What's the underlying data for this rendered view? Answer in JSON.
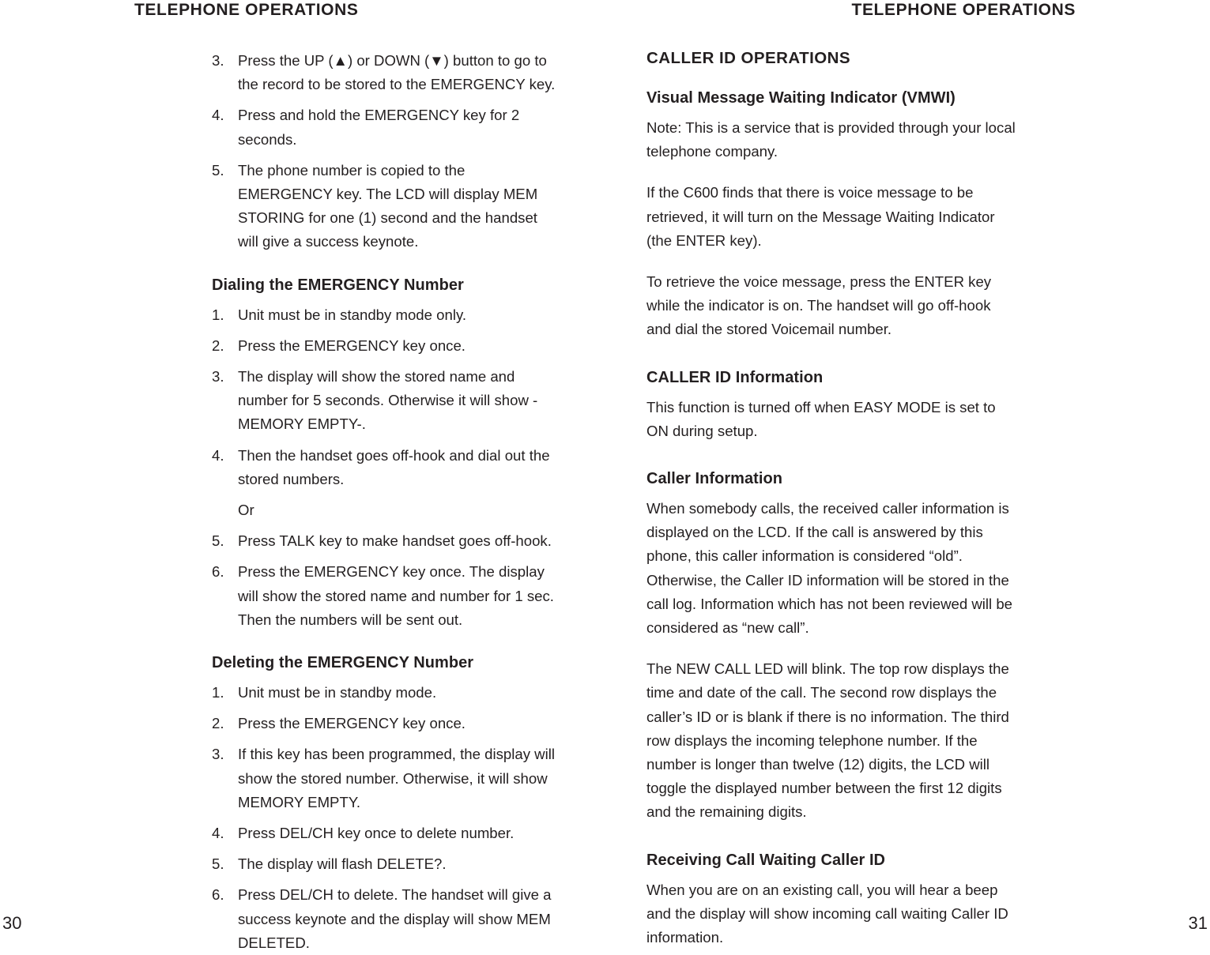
{
  "document": {
    "running_head_left": "TELEPHONE OPERATIONS",
    "running_head_right": "TELEPHONE OPERATIONS",
    "folio_left": "30",
    "folio_right": "31",
    "text_color": "#231f20",
    "background_color": "#ffffff"
  },
  "left_page": {
    "continued_steps": [
      {
        "num": "3.",
        "text": "Press the UP (▲) or DOWN (▼) button to go to the record to be stored to the EMERGENCY key."
      },
      {
        "num": "4.",
        "text": "Press and hold the EMERGENCY key for 2 seconds."
      },
      {
        "num": "5.",
        "text": "The phone number is copied to the EMERGENCY key. The LCD will display MEM STORING for one (1) second and the handset will give a success keynote."
      }
    ],
    "dialing_section": {
      "heading": "Dialing the EMERGENCY Number",
      "steps": [
        {
          "num": "1.",
          "text": "Unit must be in standby mode only."
        },
        {
          "num": "2.",
          "text": "Press the EMERGENCY key once."
        },
        {
          "num": "3.",
          "text": "The display will show the stored name and number for 5 seconds. Otherwise it will show -MEMORY EMPTY-."
        },
        {
          "num": "4.",
          "text": "Then the handset goes off-hook and dial out the stored numbers."
        },
        {
          "num": "",
          "text": "Or"
        },
        {
          "num": "5.",
          "text": "Press TALK key to make handset goes off-hook."
        },
        {
          "num": "6.",
          "text": "Press the EMERGENCY key once. The display will show the stored name and number for 1 sec. Then the numbers will be sent out."
        }
      ]
    },
    "deleting_section": {
      "heading": "Deleting the EMERGENCY Number",
      "steps": [
        {
          "num": "1.",
          "text": "Unit must be in standby mode."
        },
        {
          "num": "2.",
          "text": "Press the EMERGENCY key once."
        },
        {
          "num": "3.",
          "text": "If this key has been programmed, the display will show the stored number. Otherwise, it will show MEMORY EMPTY."
        },
        {
          "num": "4.",
          "text": "Press DEL/CH key once to delete number."
        },
        {
          "num": "5.",
          "text": "The display will flash DELETE?."
        },
        {
          "num": "6.",
          "text": "Press DEL/CH to delete. The handset will give a success keynote and the display will show MEM DELETED."
        }
      ]
    }
  },
  "right_page": {
    "section_heading": "CALLER ID OPERATIONS",
    "vmwi": {
      "heading": "Visual Message Waiting Indicator (VMWI)",
      "paragraphs": [
        "Note: This is a service that is provided through your local telephone company.",
        "If the C600 finds that there is voice message to be retrieved, it will turn on the Message Waiting Indicator (the ENTER key).",
        "To retrieve the voice message, press the ENTER key while the indicator is on. The handset will go off-hook and dial the stored Voicemail number."
      ]
    },
    "caller_id_information": {
      "heading": "CALLER ID Information",
      "paragraphs": [
        "This function is turned off when EASY MODE is set to ON during setup."
      ]
    },
    "caller_information": {
      "heading": "Caller Information",
      "paragraphs": [
        "When somebody calls, the received caller information is displayed on the LCD. If the call is answered by this phone, this caller information is considered “old”. Otherwise, the Caller ID information will be stored in the call log. Information which has not been reviewed will be considered as “new call”.",
        "The NEW CALL LED will blink. The top row displays the time and date of the call. The second row displays the caller’s ID or is blank if there is no information. The third row displays the incoming telephone number. If the number is longer than twelve (12) digits, the LCD will toggle the displayed number between the first 12 digits and the remaining digits."
      ]
    },
    "receiving_call_waiting": {
      "heading": "Receiving Call Waiting Caller ID",
      "paragraphs": [
        "When you are on an existing call, you will hear a beep and the display will show incoming call waiting Caller ID information."
      ]
    }
  }
}
